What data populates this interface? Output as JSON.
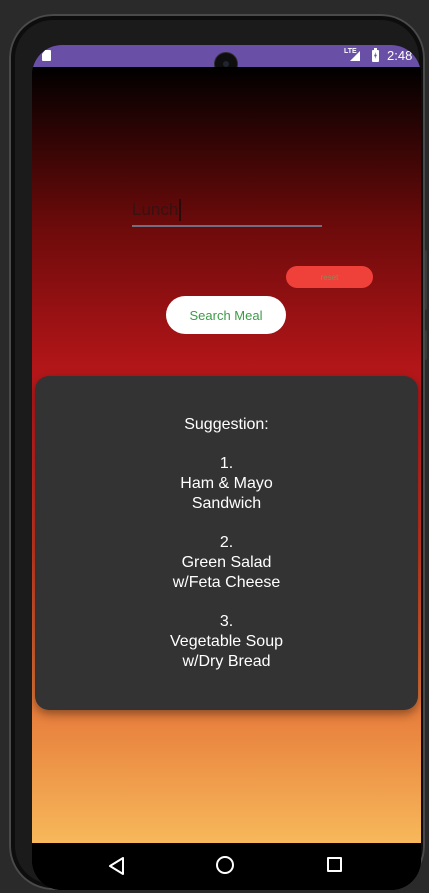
{
  "status_bar": {
    "network": "LTE",
    "time": "2:48",
    "color": "#6a4fa6",
    "icons": [
      "sd-card-icon",
      "signal-icon",
      "battery-charging-icon"
    ]
  },
  "meal_input": {
    "value": "Lunch"
  },
  "buttons": {
    "reset_label": "reset",
    "search_label": "Search Meal",
    "reset_color": "#f0403a",
    "search_text_color": "#3d9a48"
  },
  "suggestion": {
    "heading": "Suggestion:",
    "items": [
      {
        "number": "1.",
        "lines": [
          "Ham & Mayo",
          "Sandwich"
        ]
      },
      {
        "number": "2.",
        "lines": [
          "Green Salad",
          "w/Feta Cheese"
        ]
      },
      {
        "number": "3.",
        "lines": [
          "Vegetable Soup",
          "w/Dry Bread"
        ]
      }
    ]
  },
  "nav_bar": {
    "icons": [
      "back-icon",
      "home-icon",
      "recents-icon"
    ]
  }
}
